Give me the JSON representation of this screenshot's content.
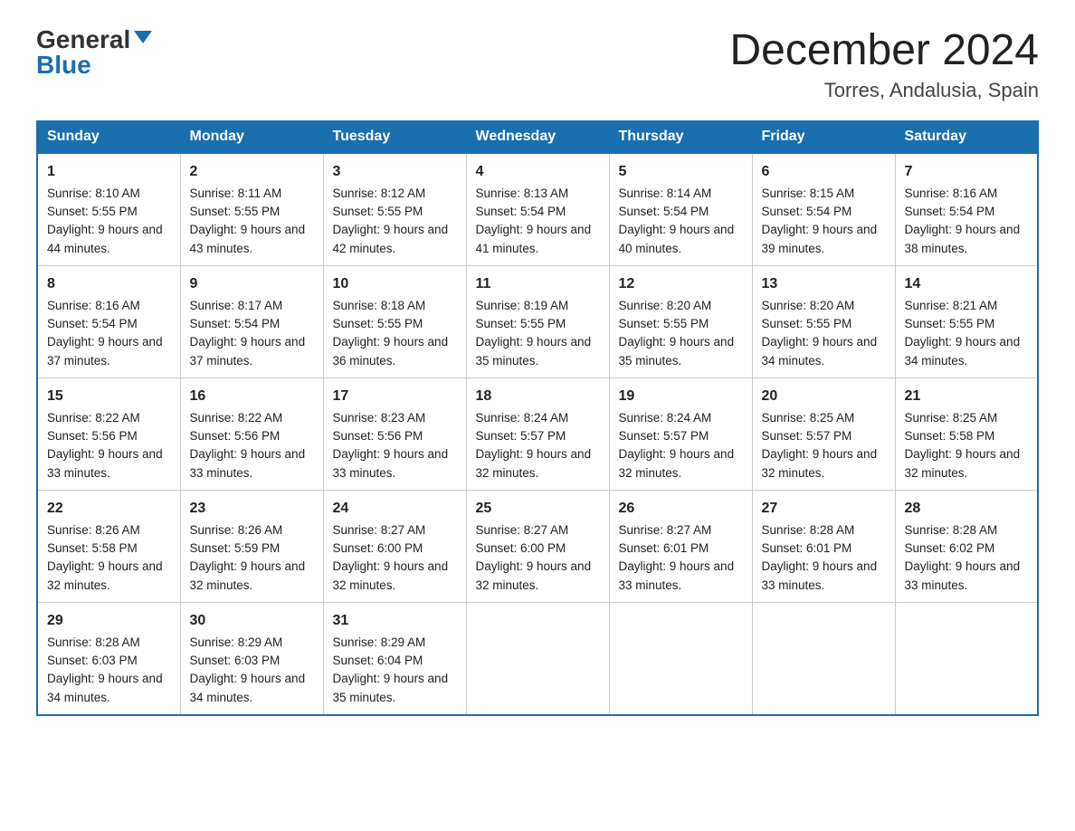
{
  "header": {
    "logo_general": "General",
    "logo_blue": "Blue",
    "month_year": "December 2024",
    "location": "Torres, Andalusia, Spain"
  },
  "days_of_week": [
    "Sunday",
    "Monday",
    "Tuesday",
    "Wednesday",
    "Thursday",
    "Friday",
    "Saturday"
  ],
  "weeks": [
    [
      {
        "day": "1",
        "sunrise": "8:10 AM",
        "sunset": "5:55 PM",
        "daylight": "9 hours and 44 minutes."
      },
      {
        "day": "2",
        "sunrise": "8:11 AM",
        "sunset": "5:55 PM",
        "daylight": "9 hours and 43 minutes."
      },
      {
        "day": "3",
        "sunrise": "8:12 AM",
        "sunset": "5:55 PM",
        "daylight": "9 hours and 42 minutes."
      },
      {
        "day": "4",
        "sunrise": "8:13 AM",
        "sunset": "5:54 PM",
        "daylight": "9 hours and 41 minutes."
      },
      {
        "day": "5",
        "sunrise": "8:14 AM",
        "sunset": "5:54 PM",
        "daylight": "9 hours and 40 minutes."
      },
      {
        "day": "6",
        "sunrise": "8:15 AM",
        "sunset": "5:54 PM",
        "daylight": "9 hours and 39 minutes."
      },
      {
        "day": "7",
        "sunrise": "8:16 AM",
        "sunset": "5:54 PM",
        "daylight": "9 hours and 38 minutes."
      }
    ],
    [
      {
        "day": "8",
        "sunrise": "8:16 AM",
        "sunset": "5:54 PM",
        "daylight": "9 hours and 37 minutes."
      },
      {
        "day": "9",
        "sunrise": "8:17 AM",
        "sunset": "5:54 PM",
        "daylight": "9 hours and 37 minutes."
      },
      {
        "day": "10",
        "sunrise": "8:18 AM",
        "sunset": "5:55 PM",
        "daylight": "9 hours and 36 minutes."
      },
      {
        "day": "11",
        "sunrise": "8:19 AM",
        "sunset": "5:55 PM",
        "daylight": "9 hours and 35 minutes."
      },
      {
        "day": "12",
        "sunrise": "8:20 AM",
        "sunset": "5:55 PM",
        "daylight": "9 hours and 35 minutes."
      },
      {
        "day": "13",
        "sunrise": "8:20 AM",
        "sunset": "5:55 PM",
        "daylight": "9 hours and 34 minutes."
      },
      {
        "day": "14",
        "sunrise": "8:21 AM",
        "sunset": "5:55 PM",
        "daylight": "9 hours and 34 minutes."
      }
    ],
    [
      {
        "day": "15",
        "sunrise": "8:22 AM",
        "sunset": "5:56 PM",
        "daylight": "9 hours and 33 minutes."
      },
      {
        "day": "16",
        "sunrise": "8:22 AM",
        "sunset": "5:56 PM",
        "daylight": "9 hours and 33 minutes."
      },
      {
        "day": "17",
        "sunrise": "8:23 AM",
        "sunset": "5:56 PM",
        "daylight": "9 hours and 33 minutes."
      },
      {
        "day": "18",
        "sunrise": "8:24 AM",
        "sunset": "5:57 PM",
        "daylight": "9 hours and 32 minutes."
      },
      {
        "day": "19",
        "sunrise": "8:24 AM",
        "sunset": "5:57 PM",
        "daylight": "9 hours and 32 minutes."
      },
      {
        "day": "20",
        "sunrise": "8:25 AM",
        "sunset": "5:57 PM",
        "daylight": "9 hours and 32 minutes."
      },
      {
        "day": "21",
        "sunrise": "8:25 AM",
        "sunset": "5:58 PM",
        "daylight": "9 hours and 32 minutes."
      }
    ],
    [
      {
        "day": "22",
        "sunrise": "8:26 AM",
        "sunset": "5:58 PM",
        "daylight": "9 hours and 32 minutes."
      },
      {
        "day": "23",
        "sunrise": "8:26 AM",
        "sunset": "5:59 PM",
        "daylight": "9 hours and 32 minutes."
      },
      {
        "day": "24",
        "sunrise": "8:27 AM",
        "sunset": "6:00 PM",
        "daylight": "9 hours and 32 minutes."
      },
      {
        "day": "25",
        "sunrise": "8:27 AM",
        "sunset": "6:00 PM",
        "daylight": "9 hours and 32 minutes."
      },
      {
        "day": "26",
        "sunrise": "8:27 AM",
        "sunset": "6:01 PM",
        "daylight": "9 hours and 33 minutes."
      },
      {
        "day": "27",
        "sunrise": "8:28 AM",
        "sunset": "6:01 PM",
        "daylight": "9 hours and 33 minutes."
      },
      {
        "day": "28",
        "sunrise": "8:28 AM",
        "sunset": "6:02 PM",
        "daylight": "9 hours and 33 minutes."
      }
    ],
    [
      {
        "day": "29",
        "sunrise": "8:28 AM",
        "sunset": "6:03 PM",
        "daylight": "9 hours and 34 minutes."
      },
      {
        "day": "30",
        "sunrise": "8:29 AM",
        "sunset": "6:03 PM",
        "daylight": "9 hours and 34 minutes."
      },
      {
        "day": "31",
        "sunrise": "8:29 AM",
        "sunset": "6:04 PM",
        "daylight": "9 hours and 35 minutes."
      },
      null,
      null,
      null,
      null
    ]
  ],
  "labels": {
    "sunrise": "Sunrise:",
    "sunset": "Sunset:",
    "daylight": "Daylight:"
  }
}
